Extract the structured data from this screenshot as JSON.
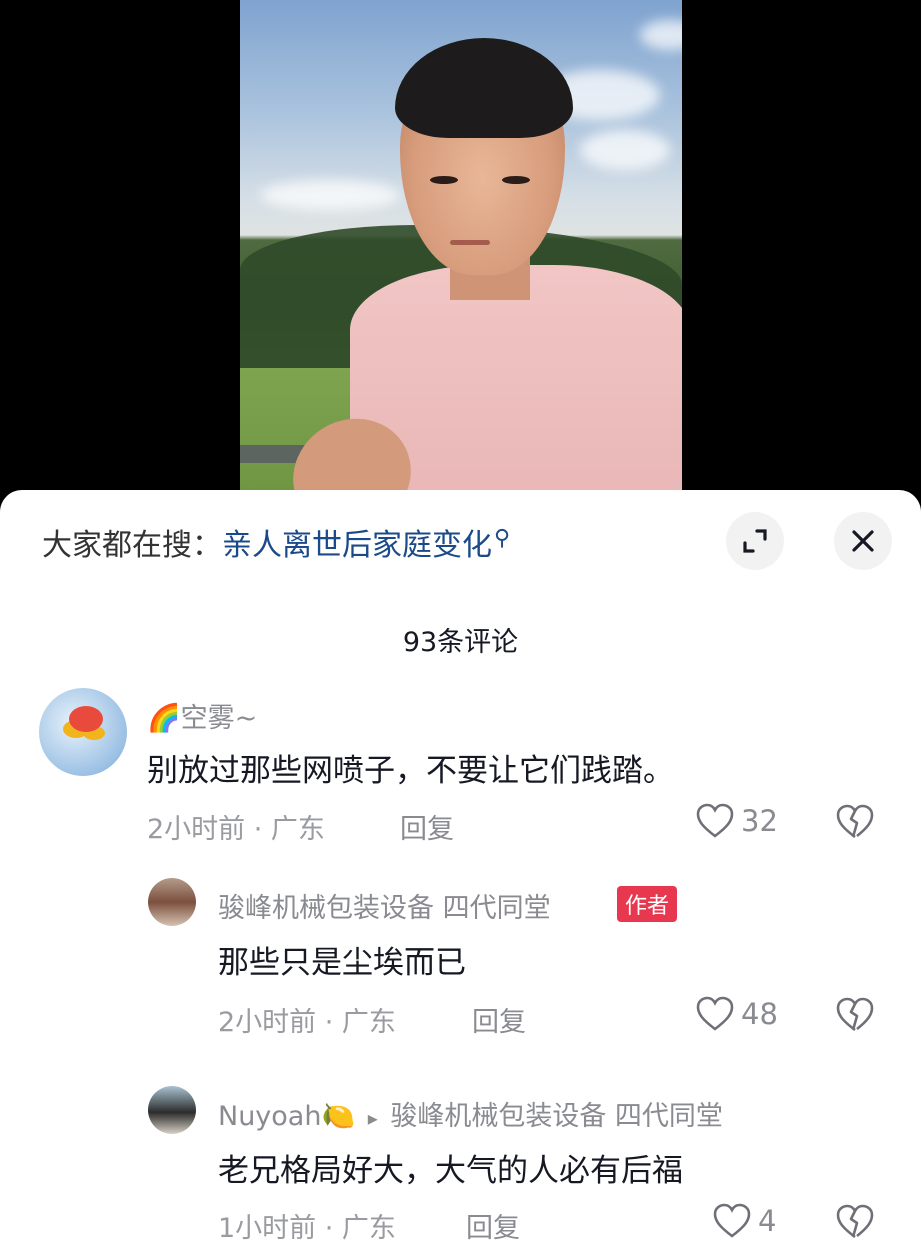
{
  "search": {
    "prefix": "大家都在搜：",
    "query": "亲人离世后家庭变化",
    "icon": "search-icon"
  },
  "controls": {
    "expand_icon": "expand-icon",
    "close_icon": "close-icon"
  },
  "comment_count": "93条评论",
  "comments": [
    {
      "username": "🌈空雾~",
      "text": "别放过那些网喷子，不要让它们践踏。",
      "time_location": "2小时前 · 广东",
      "reply_label": "回复",
      "likes": "32"
    },
    {
      "username": "骏峰机械包装设备 四代同堂",
      "badge": "作者",
      "text": "那些只是尘埃而已",
      "time_location": "2小时前 · 广东",
      "reply_label": "回复",
      "likes": "48"
    },
    {
      "username": "Nuyoah🍋",
      "arrow": "▸",
      "reply_to": "骏峰机械包装设备 四代同堂",
      "text": "老兄格局好大，大气的人必有后福",
      "time_location": "1小时前 · 广东",
      "reply_label": "回复",
      "likes": "4"
    }
  ]
}
